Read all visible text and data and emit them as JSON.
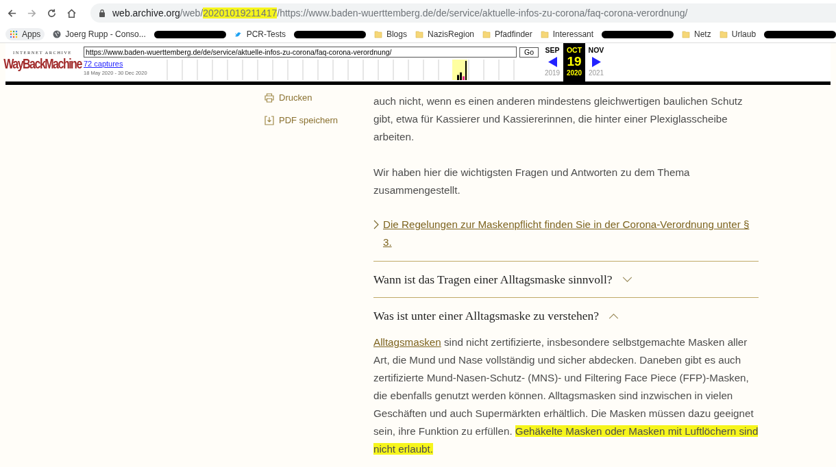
{
  "browser": {
    "url_segments": [
      {
        "text": "web.archive.org",
        "kind": "host",
        "highlighted": false
      },
      {
        "text": "/web/",
        "kind": "path",
        "highlighted": false
      },
      {
        "text": "20201019211417",
        "kind": "path",
        "highlighted": true
      },
      {
        "text": "/https://www.baden-wuerttemberg.de/de/service/aktuelle-infos-zu-corona/faq-corona-verordnung/",
        "kind": "path",
        "highlighted": false
      }
    ]
  },
  "bookmarks": [
    {
      "kind": "apps",
      "label": "Apps"
    },
    {
      "kind": "globe",
      "label": "Joerg Rupp - Conso..."
    },
    {
      "kind": "redacted"
    },
    {
      "kind": "bird",
      "label": "PCR-Tests"
    },
    {
      "kind": "redacted"
    },
    {
      "kind": "folder",
      "label": "Blogs"
    },
    {
      "kind": "folder",
      "label": "NazisRegion"
    },
    {
      "kind": "folder",
      "label": "Pfadfinder"
    },
    {
      "kind": "folder",
      "label": "Interessant"
    },
    {
      "kind": "redacted"
    },
    {
      "kind": "folder",
      "label": "Netz"
    },
    {
      "kind": "folder",
      "label": "Urlaub"
    },
    {
      "kind": "redacted"
    }
  ],
  "wayback": {
    "logo_top": "INTERNET ARCHIVE",
    "logo": "WayBackMachine",
    "url": "https://www.baden-wuerttemberg.de/de/service/aktuelle-infos-zu-corona/faq-corona-verordnung/",
    "go": "Go",
    "captures": "72 captures",
    "range": "18 May 2020 - 30 Dec 2020",
    "months": [
      {
        "label": "SEP",
        "selected": false
      },
      {
        "label": "OCT",
        "selected": true
      },
      {
        "label": "NOV",
        "selected": false
      }
    ],
    "day": "19",
    "years": [
      {
        "label": "2019",
        "selected": false
      },
      {
        "label": "2020",
        "selected": true
      },
      {
        "label": "2021",
        "selected": false
      }
    ]
  },
  "actions": [
    {
      "kind": "print",
      "label": "Drucken"
    },
    {
      "kind": "pdf",
      "label": "PDF speichern"
    }
  ],
  "paragraphs": [
    "auch nicht, wenn es einen anderen mindestens gleichwertigen baulichen Schutz gibt, etwa für Kassierer und Kassiererinnen, die hinter einer Plexiglasscheibe arbeiten.",
    "Wir haben hier die wichtigsten Fragen und Antworten zu dem Thema zusammengestellt."
  ],
  "link": "Die Regelungen zur Maskenpflicht finden Sie in der Corona-Verordnung unter § 3.",
  "faq": [
    {
      "question": "Wann ist das Tragen einer Alltagsmaske sinnvoll?",
      "expanded": false
    },
    {
      "question": "Was ist unter einer Alltagsmaske zu verstehen?",
      "expanded": true,
      "answer": [
        {
          "kind": "link",
          "text": "Alltagsmasken"
        },
        {
          "kind": "plain",
          "text": " sind nicht zertifizierte, insbesondere selbstgemachte Masken aller Art, die Mund und Nase vollständig und sicher abdecken. Daneben gibt es auch zertifizierte Mund-Nasen-Schutz- (MNS)- und Filtering Face Piece (FFP)-Masken, die ebenfalls genutzt werden können. Alltagsmasken sind inzwischen in vielen Geschäften und auch Supermärkten erhältlich. Die Masken müssen dazu geeignet sein, ihre Funktion zu erfüllen. "
        },
        {
          "kind": "highlight",
          "text": "Gehäkelte Masken oder Masken mit Luftlöchern sind nicht erlaubt."
        }
      ]
    }
  ]
}
